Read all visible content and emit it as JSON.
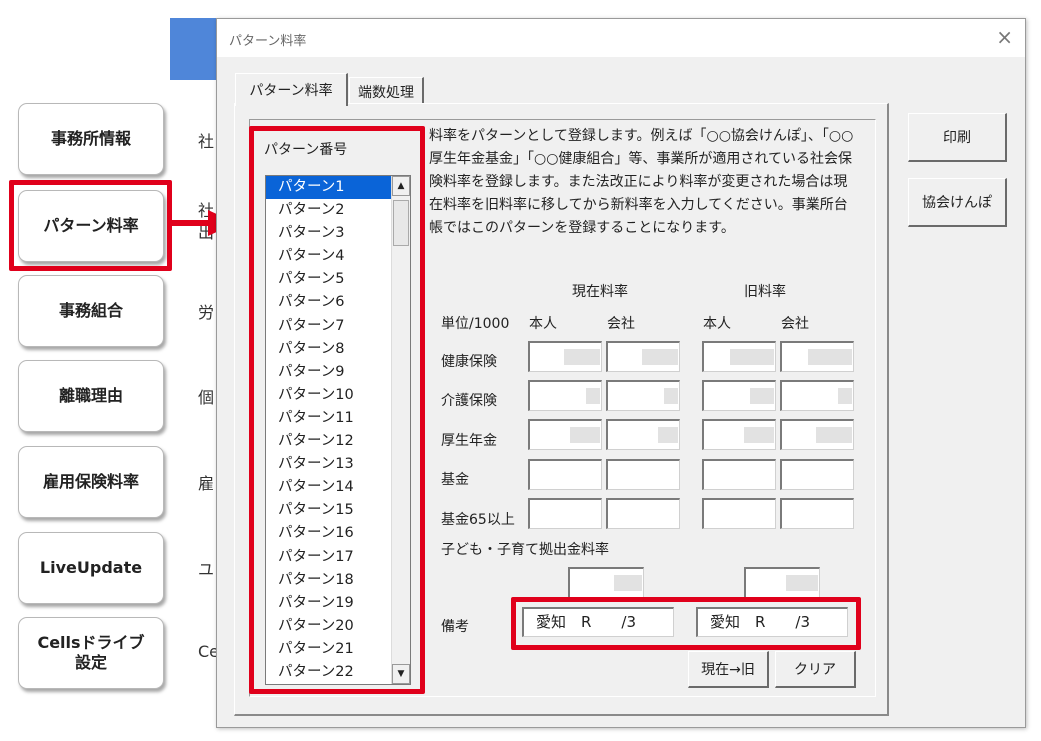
{
  "sidebar": {
    "buttons": [
      {
        "label": "事務所情報",
        "text": "社"
      },
      {
        "label": "パターン料率",
        "text": "社\n出"
      },
      {
        "label": "事務組合",
        "text": "労"
      },
      {
        "label": "離職理由",
        "text": "個"
      },
      {
        "label": "雇用保険料率",
        "text": "雇"
      },
      {
        "label": "LiveUpdate",
        "text": "ユ"
      },
      {
        "label": "Cellsドライブ\n設定",
        "text": "Ce"
      }
    ]
  },
  "dialog": {
    "title": "パターン料率",
    "close": "×",
    "tabs": [
      "パターン料率",
      "端数処理"
    ],
    "side_buttons": {
      "print": "印刷",
      "kyokai": "協会けんぽ"
    },
    "list_label": "パターン番号",
    "patterns": [
      "パターン1",
      "パターン2",
      "パターン3",
      "パターン4",
      "パターン5",
      "パターン6",
      "パターン7",
      "パターン8",
      "パターン9",
      "パターン10",
      "パターン11",
      "パターン12",
      "パターン13",
      "パターン14",
      "パターン15",
      "パターン16",
      "パターン17",
      "パターン18",
      "パターン19",
      "パターン20",
      "パターン21",
      "パターン22"
    ],
    "selected_pattern": "パターン1",
    "description": "料率をパターンとして登録します。例えば「○○協会けんぽ」、「○○厚生年金基金」「○○健康組合」等、事業所が適用されている社会保険料率を登録します。また法改正により料率が変更された場合は現在料率を旧料率に移してから新料率を入力してください。事業所台帳ではこのパターンを登録することになります。",
    "headers": {
      "current": "現在料率",
      "old": "旧料率",
      "unit": "単位/1000",
      "person": "本人",
      "company": "会社",
      "person2": "本人",
      "company2": "会社"
    },
    "rows": [
      "健康保険",
      "介護保険",
      "厚生年金",
      "基金",
      "基金65以上"
    ],
    "child_label": "子ども・子育て拠出金料率",
    "memo_label": "備考",
    "memo_current": "愛知　R　　/3",
    "memo_old": "愛知　R　　/3",
    "buttons": {
      "move": "現在→旧",
      "clear": "クリア"
    }
  },
  "colors": {
    "highlight": "#e0001b",
    "selection": "#0a64d8",
    "accent": "#4f86d9"
  }
}
